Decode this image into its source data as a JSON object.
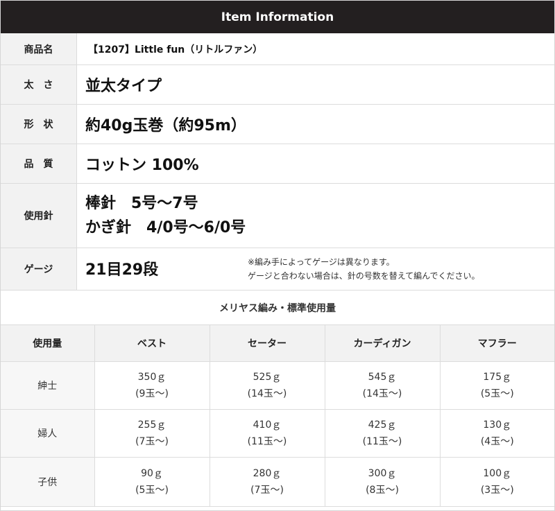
{
  "header": {
    "title": "Item Information"
  },
  "info": {
    "product_name": {
      "label": "商品名",
      "value": "【1207】Little fun（リトルファン）"
    },
    "thickness": {
      "label": "太　さ",
      "value": "並太タイプ"
    },
    "shape": {
      "label": "形　状",
      "value": "約40g玉巻（約95m）"
    },
    "quality": {
      "label": "品　質",
      "value": "コットン 100%"
    },
    "needle": {
      "label": "使用針",
      "line1": "棒針　5号～7号",
      "line2": "かぎ針　4/0号～6/0号"
    },
    "gauge": {
      "label": "ゲージ",
      "value": "21目29段",
      "note1": "※編み手によってゲージは異なります。",
      "note2": "ゲージと合わない場合は、針の号数を替えて編んでください。"
    }
  },
  "usage": {
    "title": "メリヤス編み・標準使用量",
    "headers": [
      "使用量",
      "ベスト",
      "セーター",
      "カーディガン",
      "マフラー"
    ],
    "rows": [
      {
        "label": "紳士",
        "cells": [
          [
            "350ｇ",
            "(9玉～)"
          ],
          [
            "525ｇ",
            "(14玉～)"
          ],
          [
            "545ｇ",
            "(14玉～)"
          ],
          [
            "175ｇ",
            "(5玉～)"
          ]
        ]
      },
      {
        "label": "婦人",
        "cells": [
          [
            "255ｇ",
            "(7玉～)"
          ],
          [
            "410ｇ",
            "(11玉～)"
          ],
          [
            "425ｇ",
            "(11玉～)"
          ],
          [
            "130ｇ",
            "(4玉～)"
          ]
        ]
      },
      {
        "label": "子供",
        "cells": [
          [
            "90ｇ",
            "(5玉～)"
          ],
          [
            "280ｇ",
            "(7玉～)"
          ],
          [
            "300ｇ",
            "(8玉～)"
          ],
          [
            "100ｇ",
            "(3玉～)"
          ]
        ]
      }
    ]
  }
}
